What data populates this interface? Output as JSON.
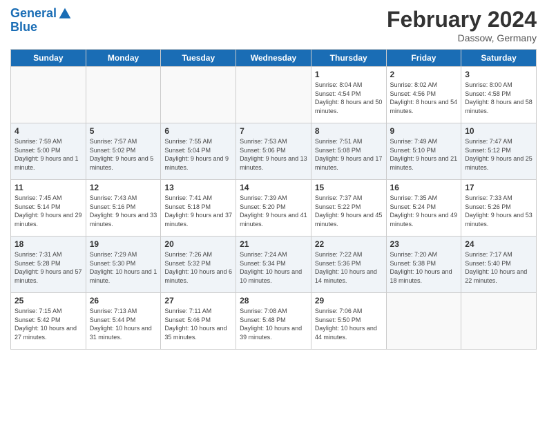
{
  "header": {
    "logo_line1": "General",
    "logo_line2": "Blue",
    "month_title": "February 2024",
    "location": "Dassow, Germany"
  },
  "weekdays": [
    "Sunday",
    "Monday",
    "Tuesday",
    "Wednesday",
    "Thursday",
    "Friday",
    "Saturday"
  ],
  "weeks": [
    [
      {
        "day": "",
        "sunrise": "",
        "sunset": "",
        "daylight": ""
      },
      {
        "day": "",
        "sunrise": "",
        "sunset": "",
        "daylight": ""
      },
      {
        "day": "",
        "sunrise": "",
        "sunset": "",
        "daylight": ""
      },
      {
        "day": "",
        "sunrise": "",
        "sunset": "",
        "daylight": ""
      },
      {
        "day": "1",
        "sunrise": "Sunrise: 8:04 AM",
        "sunset": "Sunset: 4:54 PM",
        "daylight": "Daylight: 8 hours and 50 minutes."
      },
      {
        "day": "2",
        "sunrise": "Sunrise: 8:02 AM",
        "sunset": "Sunset: 4:56 PM",
        "daylight": "Daylight: 8 hours and 54 minutes."
      },
      {
        "day": "3",
        "sunrise": "Sunrise: 8:00 AM",
        "sunset": "Sunset: 4:58 PM",
        "daylight": "Daylight: 8 hours and 58 minutes."
      }
    ],
    [
      {
        "day": "4",
        "sunrise": "Sunrise: 7:59 AM",
        "sunset": "Sunset: 5:00 PM",
        "daylight": "Daylight: 9 hours and 1 minute."
      },
      {
        "day": "5",
        "sunrise": "Sunrise: 7:57 AM",
        "sunset": "Sunset: 5:02 PM",
        "daylight": "Daylight: 9 hours and 5 minutes."
      },
      {
        "day": "6",
        "sunrise": "Sunrise: 7:55 AM",
        "sunset": "Sunset: 5:04 PM",
        "daylight": "Daylight: 9 hours and 9 minutes."
      },
      {
        "day": "7",
        "sunrise": "Sunrise: 7:53 AM",
        "sunset": "Sunset: 5:06 PM",
        "daylight": "Daylight: 9 hours and 13 minutes."
      },
      {
        "day": "8",
        "sunrise": "Sunrise: 7:51 AM",
        "sunset": "Sunset: 5:08 PM",
        "daylight": "Daylight: 9 hours and 17 minutes."
      },
      {
        "day": "9",
        "sunrise": "Sunrise: 7:49 AM",
        "sunset": "Sunset: 5:10 PM",
        "daylight": "Daylight: 9 hours and 21 minutes."
      },
      {
        "day": "10",
        "sunrise": "Sunrise: 7:47 AM",
        "sunset": "Sunset: 5:12 PM",
        "daylight": "Daylight: 9 hours and 25 minutes."
      }
    ],
    [
      {
        "day": "11",
        "sunrise": "Sunrise: 7:45 AM",
        "sunset": "Sunset: 5:14 PM",
        "daylight": "Daylight: 9 hours and 29 minutes."
      },
      {
        "day": "12",
        "sunrise": "Sunrise: 7:43 AM",
        "sunset": "Sunset: 5:16 PM",
        "daylight": "Daylight: 9 hours and 33 minutes."
      },
      {
        "day": "13",
        "sunrise": "Sunrise: 7:41 AM",
        "sunset": "Sunset: 5:18 PM",
        "daylight": "Daylight: 9 hours and 37 minutes."
      },
      {
        "day": "14",
        "sunrise": "Sunrise: 7:39 AM",
        "sunset": "Sunset: 5:20 PM",
        "daylight": "Daylight: 9 hours and 41 minutes."
      },
      {
        "day": "15",
        "sunrise": "Sunrise: 7:37 AM",
        "sunset": "Sunset: 5:22 PM",
        "daylight": "Daylight: 9 hours and 45 minutes."
      },
      {
        "day": "16",
        "sunrise": "Sunrise: 7:35 AM",
        "sunset": "Sunset: 5:24 PM",
        "daylight": "Daylight: 9 hours and 49 minutes."
      },
      {
        "day": "17",
        "sunrise": "Sunrise: 7:33 AM",
        "sunset": "Sunset: 5:26 PM",
        "daylight": "Daylight: 9 hours and 53 minutes."
      }
    ],
    [
      {
        "day": "18",
        "sunrise": "Sunrise: 7:31 AM",
        "sunset": "Sunset: 5:28 PM",
        "daylight": "Daylight: 9 hours and 57 minutes."
      },
      {
        "day": "19",
        "sunrise": "Sunrise: 7:29 AM",
        "sunset": "Sunset: 5:30 PM",
        "daylight": "Daylight: 10 hours and 1 minute."
      },
      {
        "day": "20",
        "sunrise": "Sunrise: 7:26 AM",
        "sunset": "Sunset: 5:32 PM",
        "daylight": "Daylight: 10 hours and 6 minutes."
      },
      {
        "day": "21",
        "sunrise": "Sunrise: 7:24 AM",
        "sunset": "Sunset: 5:34 PM",
        "daylight": "Daylight: 10 hours and 10 minutes."
      },
      {
        "day": "22",
        "sunrise": "Sunrise: 7:22 AM",
        "sunset": "Sunset: 5:36 PM",
        "daylight": "Daylight: 10 hours and 14 minutes."
      },
      {
        "day": "23",
        "sunrise": "Sunrise: 7:20 AM",
        "sunset": "Sunset: 5:38 PM",
        "daylight": "Daylight: 10 hours and 18 minutes."
      },
      {
        "day": "24",
        "sunrise": "Sunrise: 7:17 AM",
        "sunset": "Sunset: 5:40 PM",
        "daylight": "Daylight: 10 hours and 22 minutes."
      }
    ],
    [
      {
        "day": "25",
        "sunrise": "Sunrise: 7:15 AM",
        "sunset": "Sunset: 5:42 PM",
        "daylight": "Daylight: 10 hours and 27 minutes."
      },
      {
        "day": "26",
        "sunrise": "Sunrise: 7:13 AM",
        "sunset": "Sunset: 5:44 PM",
        "daylight": "Daylight: 10 hours and 31 minutes."
      },
      {
        "day": "27",
        "sunrise": "Sunrise: 7:11 AM",
        "sunset": "Sunset: 5:46 PM",
        "daylight": "Daylight: 10 hours and 35 minutes."
      },
      {
        "day": "28",
        "sunrise": "Sunrise: 7:08 AM",
        "sunset": "Sunset: 5:48 PM",
        "daylight": "Daylight: 10 hours and 39 minutes."
      },
      {
        "day": "29",
        "sunrise": "Sunrise: 7:06 AM",
        "sunset": "Sunset: 5:50 PM",
        "daylight": "Daylight: 10 hours and 44 minutes."
      },
      {
        "day": "",
        "sunrise": "",
        "sunset": "",
        "daylight": ""
      },
      {
        "day": "",
        "sunrise": "",
        "sunset": "",
        "daylight": ""
      }
    ]
  ]
}
